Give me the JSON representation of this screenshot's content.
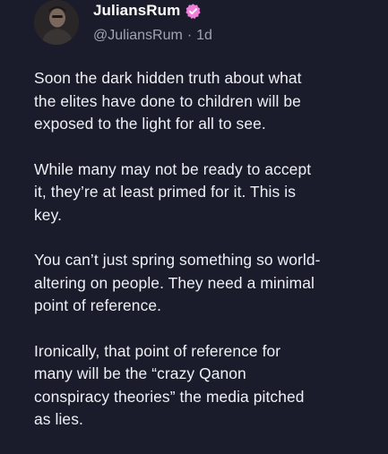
{
  "author": {
    "display_name": "JuliansRum",
    "handle": "@JuliansRum",
    "separator": "·",
    "age": "1d",
    "verified_badge_color": "#f07fd9",
    "avatar_icon": "user-avatar"
  },
  "post": {
    "paragraphs": [
      "Soon the dark hidden truth about what\nthe elites have done to children will be\nexposed to the light for all to see.",
      "While many may not be ready to accept\nit, they’re at least primed for it. This is\nkey.",
      "You can’t just spring something so world-\naltering on people. They need a minimal\npoint of reference.",
      "Ironically, that point of reference for\nmany will be the “crazy Qanon\nconspiracy theories” the media pitched\nas lies."
    ]
  },
  "colors": {
    "background": "#1a1c2b",
    "text": "#eef0f5",
    "muted": "#9ea3b5"
  }
}
